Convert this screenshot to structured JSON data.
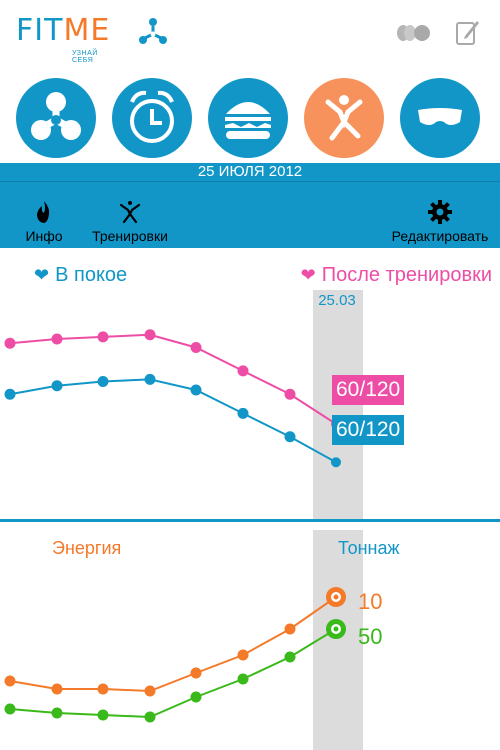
{
  "app": {
    "logo_fit": "FIT",
    "logo_me": "ME",
    "tagline": "УЗНАЙ СЕБЯ"
  },
  "colors": {
    "primary": "#1296c8",
    "accent_orange": "#f47a2a",
    "pink": "#ee4da5",
    "green": "#39b91a",
    "highlight_column": "#dcdcdc"
  },
  "nav": [
    {
      "icon": "fan-icon",
      "active": false
    },
    {
      "icon": "alarm-clock-icon",
      "active": false
    },
    {
      "icon": "burger-icon",
      "active": false
    },
    {
      "icon": "running-person-icon",
      "active": true
    },
    {
      "icon": "sleep-mask-icon",
      "active": false
    }
  ],
  "date_bar": "25 ИЮЛЯ 2012",
  "actions": {
    "info": "Инфо",
    "workouts": "Тренировки",
    "edit": "Редактировать"
  },
  "pulse_chart": {
    "legend_rest": "В покое",
    "legend_after": "После тренировки",
    "selected_date": "25.03",
    "value_after": "60/120",
    "value_rest": "60/120"
  },
  "activity_chart": {
    "label_energy": "Энергия",
    "label_tonnage": "Тоннаж",
    "value_energy": "10",
    "value_tonnage": "50"
  },
  "chart_data": [
    {
      "type": "line",
      "series": [
        {
          "name": "После тренировки",
          "color": "#ee4da5",
          "values": [
            62,
            64,
            65,
            66,
            60,
            49,
            38,
            24
          ]
        },
        {
          "name": "В покое",
          "color": "#1296c8",
          "values": [
            38,
            42,
            44,
            45,
            40,
            29,
            18,
            6
          ]
        }
      ]
    },
    {
      "type": "line",
      "series": [
        {
          "name": "Энергия",
          "color": "#f47a2a",
          "values": [
            22,
            18,
            18,
            17,
            26,
            35,
            48,
            64
          ]
        },
        {
          "name": "Тоннаж",
          "color": "#39b91a",
          "values": [
            8,
            6,
            5,
            4,
            14,
            23,
            34,
            48
          ]
        }
      ]
    }
  ]
}
